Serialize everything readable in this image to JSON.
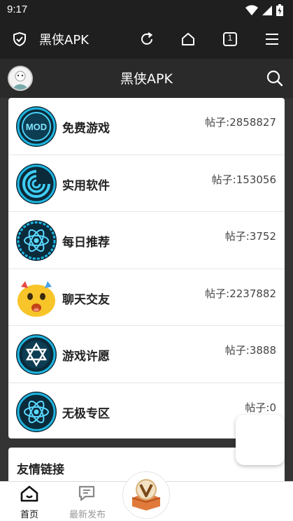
{
  "status_bar": {
    "time": "9:17"
  },
  "browser": {
    "title": "黑侠APK",
    "tab_count": "1"
  },
  "header": {
    "title": "黑侠APK"
  },
  "forums": [
    {
      "name": "免费游戏",
      "count": "帖子:2858827",
      "icon": "mod-icon"
    },
    {
      "name": "实用软件",
      "count": "帖子:153056",
      "icon": "swirl-icon"
    },
    {
      "name": "每日推荐",
      "count": "帖子:3752",
      "icon": "atom-icon"
    },
    {
      "name": "聊天交友",
      "count": "帖子:2237882",
      "icon": "emoji-icon"
    },
    {
      "name": "游戏许愿",
      "count": "帖子:3888",
      "icon": "star-of-david-icon"
    },
    {
      "name": "无极专区",
      "count": "帖子:0",
      "icon": "atom-icon"
    }
  ],
  "links": {
    "title": "友情链接"
  },
  "bottom_nav": {
    "home": "首页",
    "new_post": "最新发布"
  },
  "colors": {
    "accent_cyan": "#1fb6e0",
    "dark_bar": "#1f1f1f",
    "emoji_yellow": "#f7c42a"
  }
}
